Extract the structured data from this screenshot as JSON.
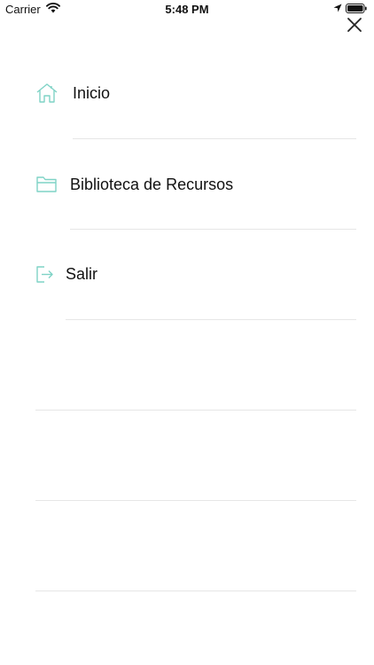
{
  "status_bar": {
    "carrier": "Carrier",
    "time": "5:48 PM"
  },
  "menu": {
    "items": [
      {
        "label": "Inicio",
        "icon": "home-icon"
      },
      {
        "label": "Biblioteca de Recursos",
        "icon": "folder-icon"
      },
      {
        "label": "Salir",
        "icon": "logout-icon"
      }
    ]
  },
  "colors": {
    "icon_accent": "#7fd3c6",
    "divider": "#e6e6e6",
    "text": "#111111"
  }
}
